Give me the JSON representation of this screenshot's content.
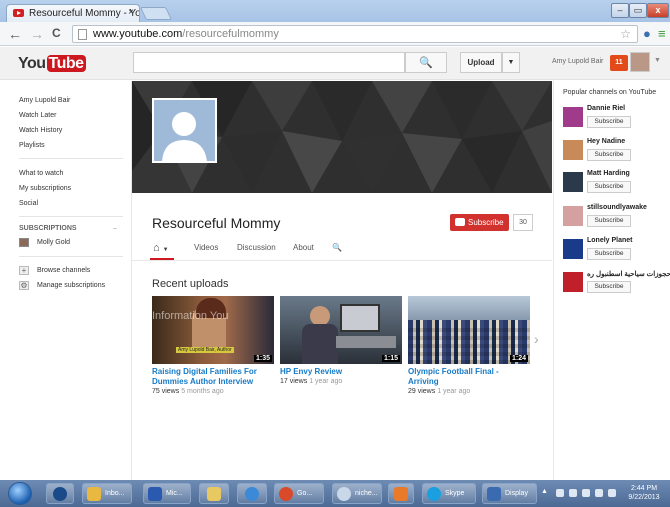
{
  "browser": {
    "tab_title": "Resourceful Mommy - Yo",
    "tab_close": "×",
    "url_host": "www.youtube.com",
    "url_path": "/resourcefulmommy",
    "back": "←",
    "forward": "→",
    "reload": "C",
    "star": "☆",
    "window_min": "–",
    "window_max": "▭",
    "window_close": "x"
  },
  "masthead": {
    "logo_you": "You",
    "logo_tube": "Tube",
    "search_icon": "🔍",
    "upload_label": "Upload",
    "upload_caret": "▼",
    "user_name": "Amy Lupold Bair",
    "notifications": "11",
    "avatar_caret": "▼"
  },
  "guide": {
    "items": [
      "Amy Lupold Bair",
      "Watch Later",
      "Watch History",
      "Playlists"
    ],
    "items2": [
      "What to watch",
      "My subscriptions",
      "Social"
    ],
    "subs_header": "SUBSCRIPTIONS",
    "subs_caret": "–",
    "subscriptions": [
      "Molly Gold"
    ],
    "browse": "Browse channels",
    "manage": "Manage subscriptions"
  },
  "channel": {
    "title": "Resourceful Mommy",
    "subscribe_label": "Subscribe",
    "subscriber_count": "30",
    "tabs": [
      "Videos",
      "Discussion",
      "About"
    ],
    "home_icon": "home-icon",
    "home_caret": "▼",
    "search_icon": "🔍",
    "section_title": "Recent uploads",
    "next_arrow": "›"
  },
  "videos": [
    {
      "title": "Raising Digital Families For Dummies Author Interview",
      "views": "75 views",
      "ago": "5 months ago",
      "duration": "1:35",
      "thumb_text": "Information You",
      "caption": "Amy Lupold Bair, Author"
    },
    {
      "title": "HP Envy Review",
      "views": "17 views",
      "ago": "1 year ago",
      "duration": "1:15"
    },
    {
      "title": "Olympic Football Final - Arriving",
      "views": "29 views",
      "ago": "1 year ago",
      "duration": "1:24"
    }
  ],
  "popular": {
    "header": "Popular channels on YouTube",
    "channels": [
      {
        "name": "Dannie Riel",
        "button": "Subscribe",
        "color": "#a03a8a"
      },
      {
        "name": "Hey Nadine",
        "button": "Subscribe",
        "color": "#c98a5a"
      },
      {
        "name": "Matt Harding",
        "button": "Subscribe",
        "color": "#2a3a4a"
      },
      {
        "name": "stillsoundlyawake",
        "button": "Subscribe",
        "color": "#d4a0a0"
      },
      {
        "name": "Lonely Planet",
        "button": "Subscribe",
        "color": "#1a3a8a"
      },
      {
        "name": "حجوزات سياحية اسطنبول ره...",
        "button": "Subscribe",
        "color": "#c0202a"
      }
    ]
  },
  "taskbar": {
    "items": [
      "Inbo...",
      "Mic...",
      "",
      "",
      "Go...",
      "niche...",
      "",
      "Skype",
      "Display"
    ],
    "time": "2:44 PM",
    "date": "9/22/2013"
  },
  "colors": {
    "brand_red": "#cc181e",
    "link_blue": "#167ac6",
    "subscribe_red": "#d2322d"
  }
}
